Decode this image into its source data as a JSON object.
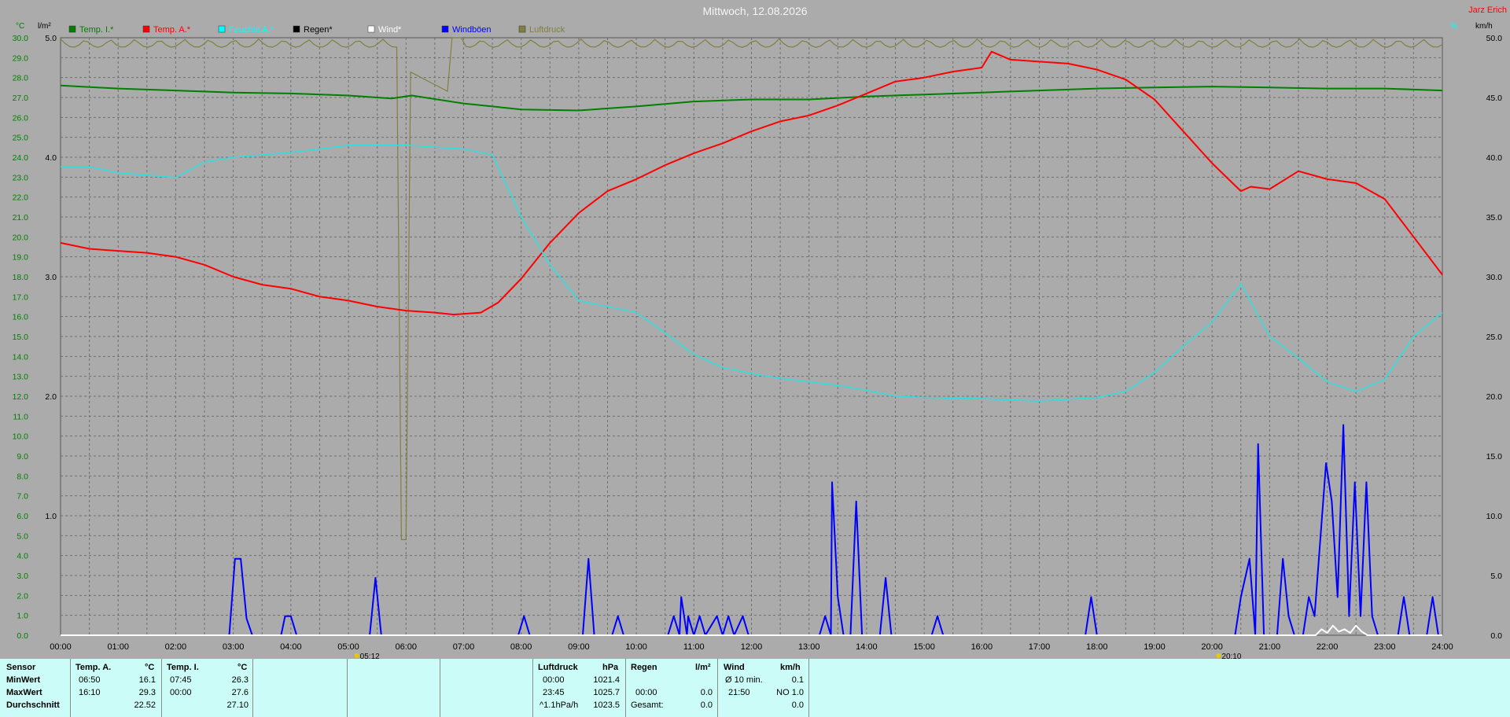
{
  "chart": {
    "title": "Mittwoch, 12.08.2026",
    "author": "Jarz Erich",
    "left_axis_unit": "°C",
    "rain_axis_unit": "l/m²",
    "right_axis_unit_a": "%",
    "right_axis_unit_b": "km/h",
    "sunrise_label": "05:12",
    "sunset_label": "20:10",
    "legend": [
      {
        "label": "Temp. I.*",
        "color": "#008000"
      },
      {
        "label": "Temp. A.*",
        "color": "#ff0000"
      },
      {
        "label": "Feuchte A.*",
        "color": "#00ffff"
      },
      {
        "label": "Regen*",
        "color": "#000000"
      },
      {
        "label": "Wind*",
        "color": "#ffffff"
      },
      {
        "label": "Windböen",
        "color": "#0000ff"
      },
      {
        "label": "Luftdruck",
        "color": "#808040"
      }
    ],
    "colors": {
      "grid": "#6f6f6f",
      "temp_in": "#008000",
      "temp_out": "#ff0000",
      "humidity": "#33dddd",
      "gust": "#0000ff",
      "pressure": "#808040",
      "wind": "#ffffff"
    }
  },
  "chart_data": {
    "type": "line",
    "x_unit": "time of day",
    "x_ticks": [
      "00:00",
      "01:00",
      "02:00",
      "03:00",
      "04:00",
      "05:00",
      "06:00",
      "07:00",
      "08:00",
      "09:00",
      "10:00",
      "11:00",
      "12:00",
      "13:00",
      "14:00",
      "15:00",
      "16:00",
      "17:00",
      "18:00",
      "19:00",
      "20:00",
      "21:00",
      "22:00",
      "23:00",
      "24:00"
    ],
    "y_left_ticks": [
      "0.0",
      "1.0",
      "2.0",
      "3.0",
      "4.0",
      "5.0",
      "6.0",
      "7.0",
      "8.0",
      "9.0",
      "10.0",
      "11.0",
      "12.0",
      "13.0",
      "14.0",
      "15.0",
      "16.0",
      "17.0",
      "18.0",
      "19.0",
      "20.0",
      "21.0",
      "22.0",
      "23.0",
      "24.0",
      "25.0",
      "26.0",
      "27.0",
      "28.0",
      "29.0",
      "30.0"
    ],
    "y_left_range": [
      0,
      30
    ],
    "y_rain_ticks": [
      "1.0",
      "2.0",
      "3.0",
      "4.0",
      "5.0"
    ],
    "y_rain_range": [
      0,
      5
    ],
    "y_right_ticks": [
      "0.0",
      "5.0",
      "10.0",
      "15.0",
      "20.0",
      "25.0",
      "30.0",
      "35.0",
      "40.0",
      "45.0",
      "50.0"
    ],
    "y_right_range": [
      0,
      50
    ],
    "grid": true,
    "series": [
      {
        "name": "Temp. I.*",
        "axis": "left",
        "points": [
          [
            0,
            27.6
          ],
          [
            1,
            27.45
          ],
          [
            2,
            27.35
          ],
          [
            3,
            27.25
          ],
          [
            4,
            27.2
          ],
          [
            5,
            27.1
          ],
          [
            5.75,
            26.95
          ],
          [
            6.1,
            27.1
          ],
          [
            7,
            26.7
          ],
          [
            8,
            26.4
          ],
          [
            9,
            26.35
          ],
          [
            10,
            26.55
          ],
          [
            11,
            26.8
          ],
          [
            12,
            26.9
          ],
          [
            13,
            26.9
          ],
          [
            14,
            27.05
          ],
          [
            15,
            27.15
          ],
          [
            16,
            27.25
          ],
          [
            17,
            27.35
          ],
          [
            18,
            27.45
          ],
          [
            19,
            27.5
          ],
          [
            20,
            27.55
          ],
          [
            21,
            27.5
          ],
          [
            22,
            27.45
          ],
          [
            23,
            27.45
          ],
          [
            24,
            27.35
          ]
        ]
      },
      {
        "name": "Temp. A.*",
        "axis": "left",
        "points": [
          [
            0,
            19.7
          ],
          [
            0.5,
            19.4
          ],
          [
            1,
            19.3
          ],
          [
            1.5,
            19.2
          ],
          [
            2,
            19.0
          ],
          [
            2.5,
            18.6
          ],
          [
            3,
            18.0
          ],
          [
            3.5,
            17.6
          ],
          [
            4,
            17.4
          ],
          [
            4.5,
            17.0
          ],
          [
            5,
            16.8
          ],
          [
            5.5,
            16.5
          ],
          [
            6,
            16.3
          ],
          [
            6.5,
            16.2
          ],
          [
            6.83,
            16.1
          ],
          [
            7.3,
            16.2
          ],
          [
            7.6,
            16.7
          ],
          [
            8,
            17.9
          ],
          [
            8.5,
            19.7
          ],
          [
            9,
            21.2
          ],
          [
            9.5,
            22.3
          ],
          [
            10,
            22.9
          ],
          [
            10.5,
            23.6
          ],
          [
            11,
            24.2
          ],
          [
            11.5,
            24.7
          ],
          [
            12,
            25.3
          ],
          [
            12.5,
            25.8
          ],
          [
            13,
            26.1
          ],
          [
            13.5,
            26.6
          ],
          [
            14,
            27.2
          ],
          [
            14.5,
            27.8
          ],
          [
            15,
            28.0
          ],
          [
            15.5,
            28.3
          ],
          [
            16,
            28.5
          ],
          [
            16.17,
            29.3
          ],
          [
            16.5,
            28.9
          ],
          [
            17,
            28.8
          ],
          [
            17.5,
            28.7
          ],
          [
            18,
            28.4
          ],
          [
            18.5,
            27.9
          ],
          [
            19,
            26.9
          ],
          [
            19.5,
            25.3
          ],
          [
            20,
            23.7
          ],
          [
            20.5,
            22.3
          ],
          [
            20.67,
            22.52
          ],
          [
            21,
            22.4
          ],
          [
            21.5,
            23.3
          ],
          [
            22,
            22.9
          ],
          [
            22.5,
            22.7
          ],
          [
            23,
            21.9
          ],
          [
            23.5,
            20.0
          ],
          [
            24,
            18.1
          ]
        ]
      },
      {
        "name": "Feuchte A.*",
        "axis": "right",
        "points": [
          [
            0,
            39.2
          ],
          [
            0.5,
            39.2
          ],
          [
            1,
            38.7
          ],
          [
            2,
            38.3
          ],
          [
            2.5,
            39.6
          ],
          [
            3,
            40.0
          ],
          [
            4,
            40.4
          ],
          [
            5,
            41.0
          ],
          [
            6,
            41.0
          ],
          [
            7,
            40.7
          ],
          [
            7.5,
            40.2
          ],
          [
            8,
            35.0
          ],
          [
            8.5,
            31.0
          ],
          [
            9,
            28.0
          ],
          [
            9.5,
            27.5
          ],
          [
            10,
            27.0
          ],
          [
            10.5,
            25.3
          ],
          [
            11,
            23.5
          ],
          [
            11.5,
            22.4
          ],
          [
            12,
            21.9
          ],
          [
            12.5,
            21.5
          ],
          [
            13,
            21.2
          ],
          [
            13.5,
            20.9
          ],
          [
            14,
            20.5
          ],
          [
            14.5,
            20.0
          ],
          [
            15,
            19.9
          ],
          [
            16,
            19.8
          ],
          [
            17,
            19.6
          ],
          [
            18,
            19.9
          ],
          [
            18.5,
            20.4
          ],
          [
            19,
            22.0
          ],
          [
            19.5,
            24.2
          ],
          [
            20,
            26.2
          ],
          [
            20.5,
            29.4
          ],
          [
            21,
            25.0
          ],
          [
            21.5,
            23.2
          ],
          [
            22,
            21.2
          ],
          [
            22.5,
            20.4
          ],
          [
            23,
            21.4
          ],
          [
            23.5,
            25.0
          ],
          [
            24,
            27.0
          ]
        ]
      },
      {
        "name": "Windböen",
        "axis": "right",
        "points": [
          [
            0,
            0
          ],
          [
            2.93,
            0
          ],
          [
            3.03,
            6.4
          ],
          [
            3.13,
            6.4
          ],
          [
            3.23,
            1.4
          ],
          [
            3.33,
            0
          ],
          [
            3.83,
            0
          ],
          [
            3.9,
            1.6
          ],
          [
            4.0,
            1.6
          ],
          [
            4.1,
            0
          ],
          [
            5.37,
            0
          ],
          [
            5.47,
            4.8
          ],
          [
            5.57,
            0
          ],
          [
            7.95,
            0
          ],
          [
            8.05,
            1.6
          ],
          [
            8.15,
            0
          ],
          [
            9.07,
            0
          ],
          [
            9.17,
            6.4
          ],
          [
            9.27,
            0
          ],
          [
            9.58,
            0
          ],
          [
            9.68,
            1.6
          ],
          [
            9.78,
            0
          ],
          [
            10.55,
            0
          ],
          [
            10.65,
            1.6
          ],
          [
            10.75,
            0
          ],
          [
            10.78,
            3.2
          ],
          [
            10.88,
            0
          ],
          [
            10.9,
            1.6
          ],
          [
            11.0,
            0
          ],
          [
            11.1,
            1.6
          ],
          [
            11.2,
            0
          ],
          [
            11.4,
            1.6
          ],
          [
            11.5,
            0
          ],
          [
            11.6,
            1.6
          ],
          [
            11.7,
            0
          ],
          [
            11.85,
            1.6
          ],
          [
            11.95,
            0
          ],
          [
            13.18,
            0
          ],
          [
            13.28,
            1.6
          ],
          [
            13.38,
            0
          ],
          [
            13.4,
            12.8
          ],
          [
            13.5,
            3.2
          ],
          [
            13.6,
            0
          ],
          [
            13.72,
            0
          ],
          [
            13.82,
            11.2
          ],
          [
            13.92,
            0
          ],
          [
            14.23,
            0
          ],
          [
            14.33,
            4.8
          ],
          [
            14.43,
            0
          ],
          [
            15.13,
            0
          ],
          [
            15.23,
            1.6
          ],
          [
            15.33,
            0
          ],
          [
            17.8,
            0
          ],
          [
            17.9,
            3.2
          ],
          [
            18.0,
            0
          ],
          [
            20.4,
            0
          ],
          [
            20.5,
            3.2
          ],
          [
            20.65,
            6.4
          ],
          [
            20.75,
            0
          ],
          [
            20.8,
            16.0
          ],
          [
            20.9,
            0
          ],
          [
            21.13,
            0
          ],
          [
            21.23,
            6.4
          ],
          [
            21.33,
            1.6
          ],
          [
            21.43,
            0
          ],
          [
            21.58,
            0
          ],
          [
            21.68,
            3.2
          ],
          [
            21.78,
            1.6
          ],
          [
            21.88,
            8.0
          ],
          [
            21.98,
            14.4
          ],
          [
            22.08,
            11.2
          ],
          [
            22.18,
            3.2
          ],
          [
            22.28,
            17.6
          ],
          [
            22.38,
            1.6
          ],
          [
            22.48,
            12.8
          ],
          [
            22.58,
            1.6
          ],
          [
            22.68,
            12.8
          ],
          [
            22.78,
            1.6
          ],
          [
            22.88,
            0
          ],
          [
            23.23,
            0
          ],
          [
            23.33,
            3.2
          ],
          [
            23.43,
            0
          ],
          [
            23.73,
            0
          ],
          [
            23.83,
            3.2
          ],
          [
            23.93,
            0
          ]
        ]
      },
      {
        "name": "Wind*",
        "axis": "right",
        "points": [
          [
            0,
            0
          ],
          [
            21.8,
            0
          ],
          [
            21.9,
            0.5
          ],
          [
            22.0,
            0.2
          ],
          [
            22.1,
            0.8
          ],
          [
            22.2,
            0.3
          ],
          [
            22.3,
            0.5
          ],
          [
            22.4,
            0.2
          ],
          [
            22.5,
            0.8
          ],
          [
            22.6,
            0.3
          ],
          [
            22.7,
            0
          ],
          [
            24,
            0
          ]
        ]
      }
    ]
  },
  "stats": {
    "sensor_header": "Sensor",
    "row_labels": [
      "MinWert",
      "MaxWert",
      "Durchschnitt"
    ],
    "temp_a": {
      "title": "Temp. A.",
      "unit": "°C",
      "min_time": "06:50",
      "min_val": "16.1",
      "max_time": "16:10",
      "max_val": "29.3",
      "avg": "22.52"
    },
    "temp_i": {
      "title": "Temp. I.",
      "unit": "°C",
      "min_time": "07:45",
      "min_val": "26.3",
      "max_time": "00:00",
      "max_val": "27.6",
      "avg": "27.10"
    },
    "pressure": {
      "title": "Luftdruck",
      "unit": "hPa",
      "min_time": "00:00",
      "min_val": "1021.4",
      "max_time": "23:45",
      "max_val": "1025.7",
      "avg_label": "^1.1hPa/h",
      "avg": "1023.5"
    },
    "rain": {
      "title": "Regen",
      "unit": "l/m²",
      "time": "00:00",
      "val": "0.0",
      "total_label": "Gesamt:",
      "total": "0.0"
    },
    "wind": {
      "title": "Wind",
      "unit": "km/h",
      "avg_label": "Ø 10 min.",
      "avg": "0.1",
      "max_time": "21:50",
      "max_val": "NO 1.0",
      "day_avg": "0.0"
    }
  }
}
